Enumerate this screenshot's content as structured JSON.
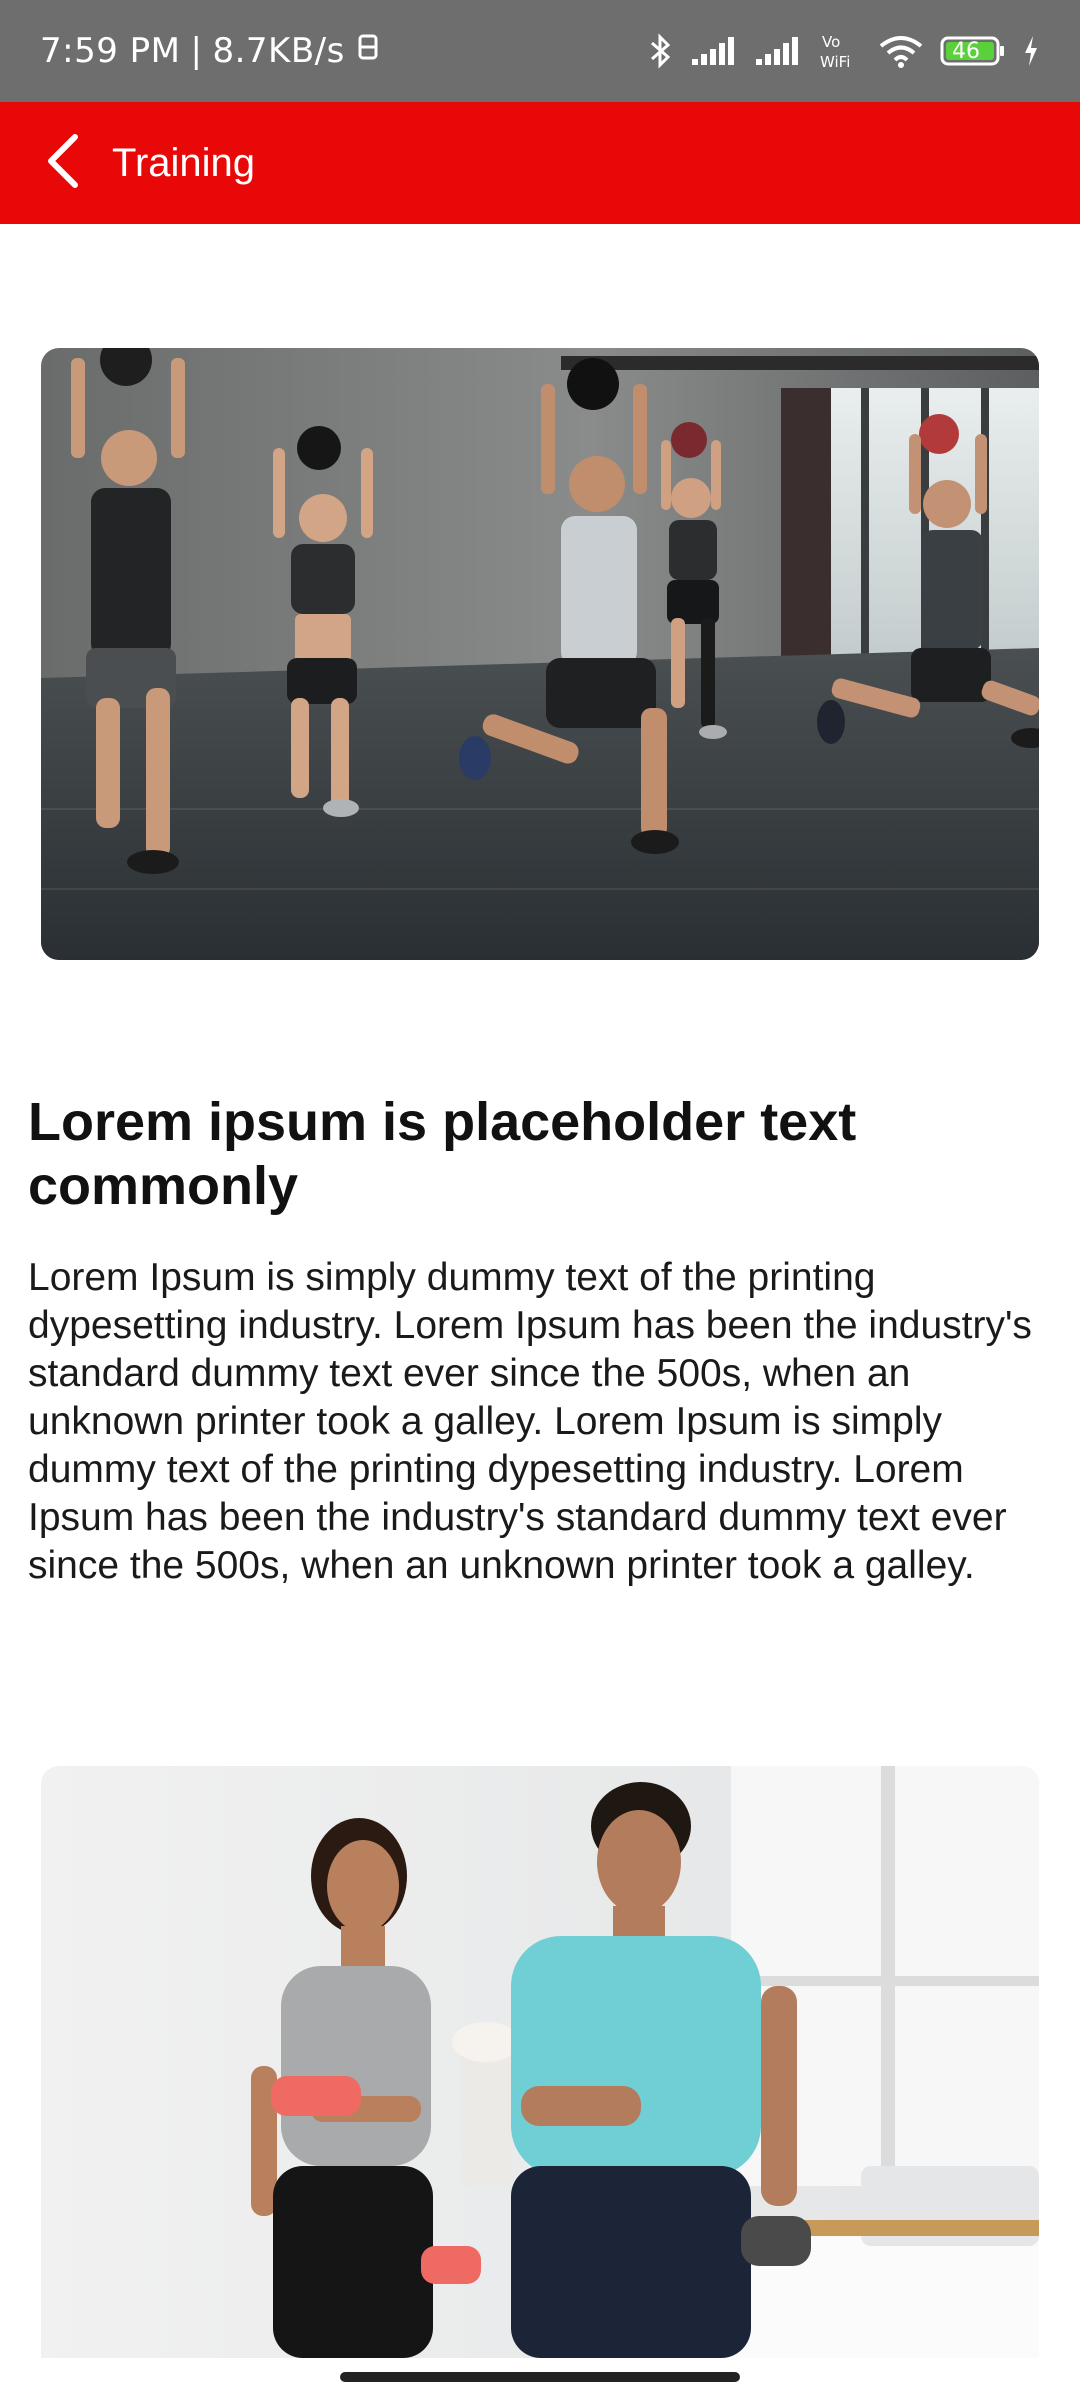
{
  "status_bar": {
    "time": "7:59 PM",
    "network_speed": "8.7KB/s",
    "wifi_label": "Vo WiFi",
    "battery_level": "46"
  },
  "app_bar": {
    "title": "Training",
    "back_icon": "chevron-left-icon",
    "background_color": "#e80808"
  },
  "content": {
    "hero_image": "group-fitness-medicine-ball-lunge-photo",
    "headline": "Lorem ipsum is placeholder text commonly",
    "body": "Lorem Ipsum is simply dummy text of the printing dypesetting industry. Lorem Ipsum has been the industry's standard dummy text ever since the 500s, when an unknown printer took a galley. Lorem Ipsum is simply dummy text of the printing dypesetting industry. Lorem Ipsum has been the industry's standard dummy text ever since the 500s, when an unknown printer took a galley.",
    "second_image": "couple-dumbbell-workout-photo"
  }
}
